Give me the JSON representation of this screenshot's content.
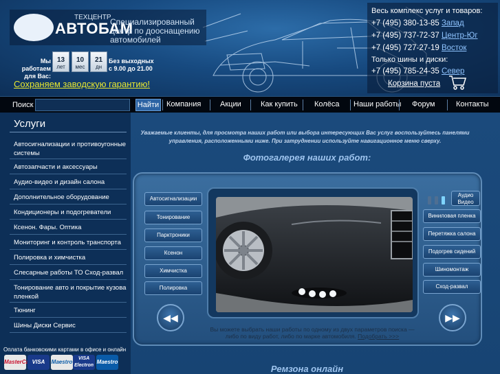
{
  "header": {
    "logo": {
      "emblem_text": "",
      "small": "ТЕХЦЕНТР",
      "name": "АВТОБАМ",
      "tagline": "Специализированный центр по дооснащению автомобилей"
    },
    "work": {
      "label": "Мы работаем для Вас:",
      "years": {
        "num": "13",
        "unit": "лет"
      },
      "months": {
        "num": "10",
        "unit": "мес"
      },
      "days": {
        "num": "21",
        "unit": "дн"
      },
      "hours": "Без выходных с 9.00 до 21.00"
    },
    "guarantee_link": "Сохраняем заводскую гарантию!",
    "contacts": {
      "title_all": "Весь комплекс услуг и товаров:",
      "phones": [
        {
          "number": "+7 (495) 380-13-85",
          "area": "Запад"
        },
        {
          "number": "+7 (495) 737-72-37",
          "area": "Центр-Юг"
        },
        {
          "number": "+7 (495) 727-27-19",
          "area": "Восток"
        }
      ],
      "title_tires": "Только шины и диски:",
      "tires_phone": {
        "number": "+7 (495) 785-24-35",
        "area": "Север"
      },
      "cart": "Корзина пуста"
    }
  },
  "nav": {
    "search_label": "Поиск",
    "search_value": "",
    "search_button": "Найти",
    "items": [
      "Компания",
      "Акции",
      "Как купить",
      "Колёса",
      "Наши работы",
      "Форум",
      "Контакты"
    ]
  },
  "sidebar": {
    "title": "Услуги",
    "items": [
      "Автосигнализации и противоугонные системы",
      "Автозапчасти и аксессуары",
      "Аудио-видео и дизайн салона",
      "Дополнительное оборудование",
      "Кондиционеры и подогреватели",
      "Ксенон. Фары. Оптика",
      "Мониторинг и контроль транспорта",
      "Полировка и химчистка",
      "Слесарные работы ТО Сход-развал",
      "Тонирование авто и покрытие кузова пленкой",
      "Тюнинг",
      "Шины Диски Сервис"
    ],
    "payment_note": "Оплата банковскими картами в офисе и онлайн",
    "cards": [
      "MasterCard",
      "VISA",
      "Maestro",
      "VISA Electron",
      "Maestro"
    ]
  },
  "main": {
    "intro": "Уважаемые клиенты, для просмотра наших работ или выбора интересующих Вас услуг воспользуйтесь панелями управления, расположенными ниже. При затруднении используйте навигационное меню сверху.",
    "gallery_title": "Фотогалерея наших работ:",
    "left_buttons": [
      "Автосигнализации",
      "Тонирование",
      "Парктроники",
      "Ксенон",
      "Химчистка",
      "Полировка"
    ],
    "right_buttons": [
      "Виниловая пленка",
      "Перетяжка салона",
      "Подогрев сидений",
      "Шиномонтаж",
      "Сход-развал"
    ],
    "audio_button": "Аудио Видео",
    "prev": "◀◀",
    "next": "▶▶",
    "note": "Вы можете выбрать наши работы по одному из двух параметров поиска — либо по виду работ, либо по марке автомобиля.",
    "note_link": "Подобрать >>>",
    "remzona": "Ремзона онлайн"
  },
  "colors": {
    "background": "#123a66",
    "accent_link": "#8fc4ff",
    "guarantee": "#e8e830"
  }
}
